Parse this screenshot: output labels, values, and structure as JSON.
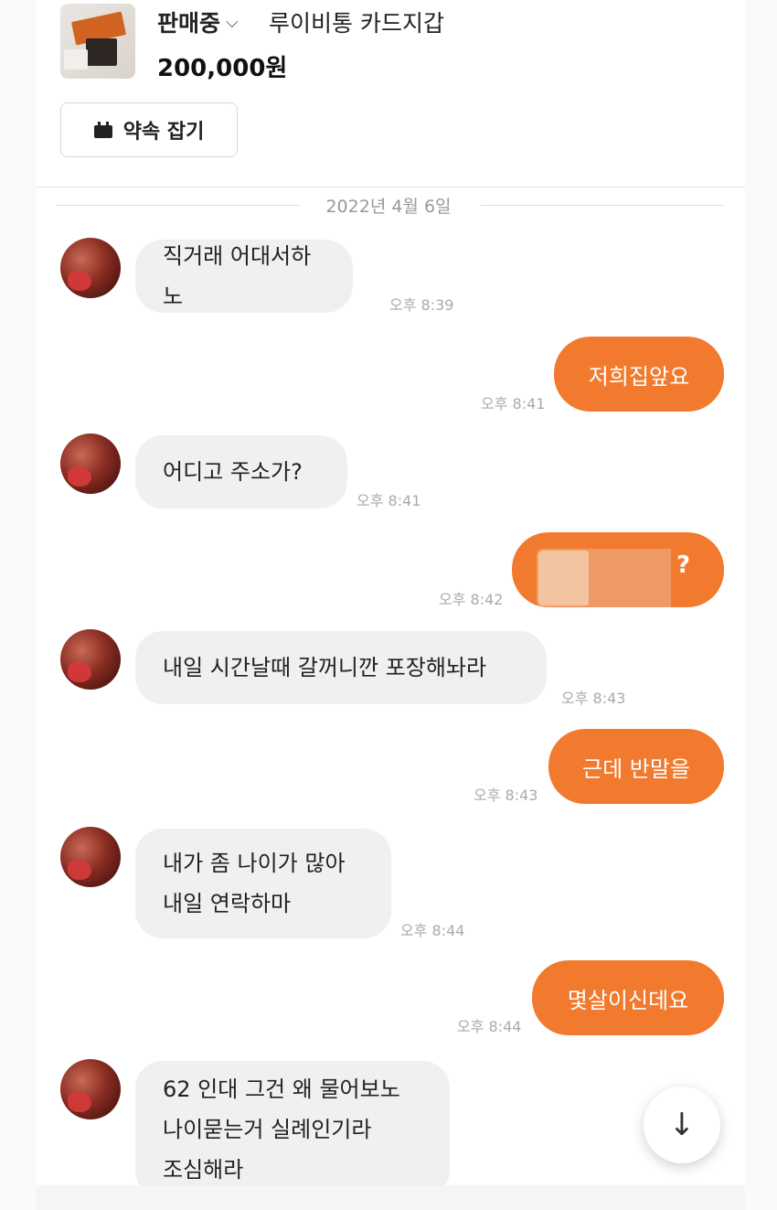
{
  "product": {
    "status": "판매중",
    "title": "루이비통 카드지갑",
    "price": "200,000원"
  },
  "appointment_button": "약속 잡기",
  "date_separator": "2022년 4월 6일",
  "messages": [
    {
      "side": "in",
      "lines": [
        "직거래 어대서하노"
      ],
      "time": "오후 8:39"
    },
    {
      "side": "out",
      "lines": [
        "저희집앞요"
      ],
      "time": "오후 8:41"
    },
    {
      "side": "in",
      "lines": [
        "어디고 주소가?"
      ],
      "time": "오후 8:41"
    },
    {
      "side": "out",
      "lines": [
        "?"
      ],
      "time": "오후 8:42"
    },
    {
      "side": "in",
      "lines": [
        "내일 시간날때 갈꺼니깐 포장해놔라"
      ],
      "time": "오후 8:43"
    },
    {
      "side": "out",
      "lines": [
        "근데 반말을"
      ],
      "time": "오후 8:43"
    },
    {
      "side": "in",
      "lines": [
        "내가 좀 나이가 많아",
        "내일 연락하마"
      ],
      "time": "오후 8:44"
    },
    {
      "side": "out",
      "lines": [
        "몇살이신데요"
      ],
      "time": "오후 8:44"
    },
    {
      "side": "in",
      "lines": [
        "62 인대 그건 왜 물어보노",
        "나이묻는거 실례인기라",
        "조심해라"
      ],
      "time": ""
    }
  ],
  "icons": {
    "chevron": "chevron-down-icon",
    "calendar": "calendar-icon",
    "scroll_down": "arrow-down-icon"
  },
  "colors": {
    "accent": "#f27a2e",
    "incoming_bubble": "#f0f0f3"
  }
}
